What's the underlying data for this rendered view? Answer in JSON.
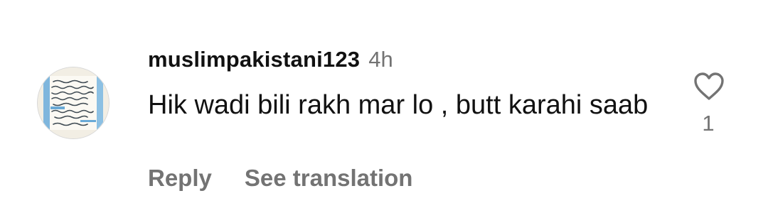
{
  "comment": {
    "username": "muslimpakistani123",
    "timestamp": "4h",
    "text": "Hik wadi bili rakh mar lo , butt karahi saab",
    "like_count": "1",
    "actions": {
      "reply_label": "Reply",
      "translate_label": "See translation"
    },
    "icons": {
      "like": "heart-outline-icon"
    },
    "colors": {
      "primary_text": "#111111",
      "secondary_text": "#737373"
    }
  }
}
